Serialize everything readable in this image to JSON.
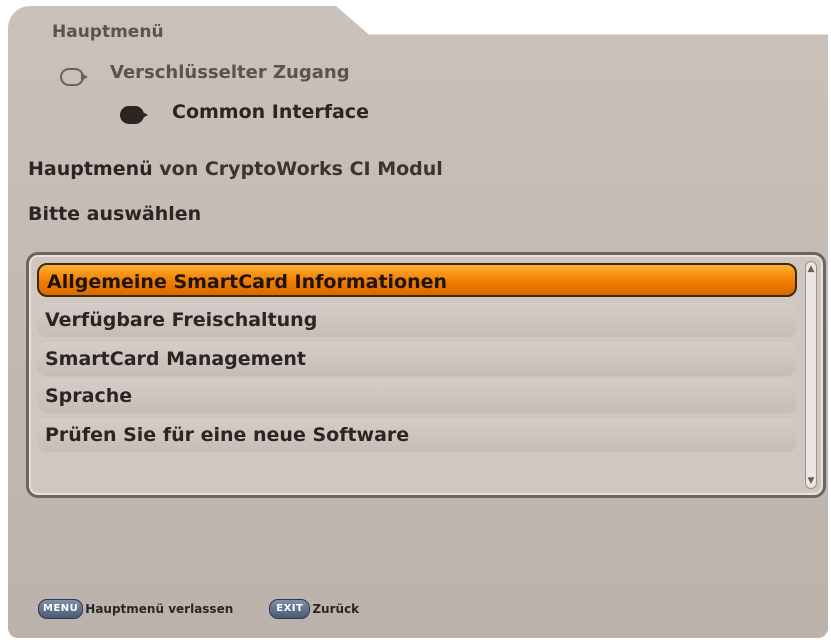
{
  "breadcrumb": {
    "root": "Hauptmenü",
    "level1": "Verschlüsselter Zugang",
    "level2": "Common Interface"
  },
  "title": {
    "strong": "Hauptmenü",
    "rest": " von CryptoWorks CI Modul"
  },
  "subtitle": "Bitte auswählen",
  "menu": {
    "selected_index": 0,
    "items": [
      {
        "label": "Allgemeine SmartCard Informationen"
      },
      {
        "label": "Verfügbare Freischaltung"
      },
      {
        "label": "SmartCard Management"
      },
      {
        "label": "Sprache"
      },
      {
        "label": "Prüfen Sie für eine neue Software"
      }
    ]
  },
  "footer": {
    "menu_key": "MENU",
    "menu_label": "Hauptmenü verlassen",
    "exit_key": "EXIT",
    "exit_label": "Zurück"
  },
  "colors": {
    "selected_bg": "#f07c00",
    "panel_bg": "#c4bab4"
  },
  "icons": {
    "breadcrumb_level1": "arrow-outline-icon",
    "breadcrumb_level2": "arrow-filled-icon",
    "scroll_up": "scroll-up-arrow-icon",
    "scroll_down": "scroll-down-arrow-icon"
  }
}
